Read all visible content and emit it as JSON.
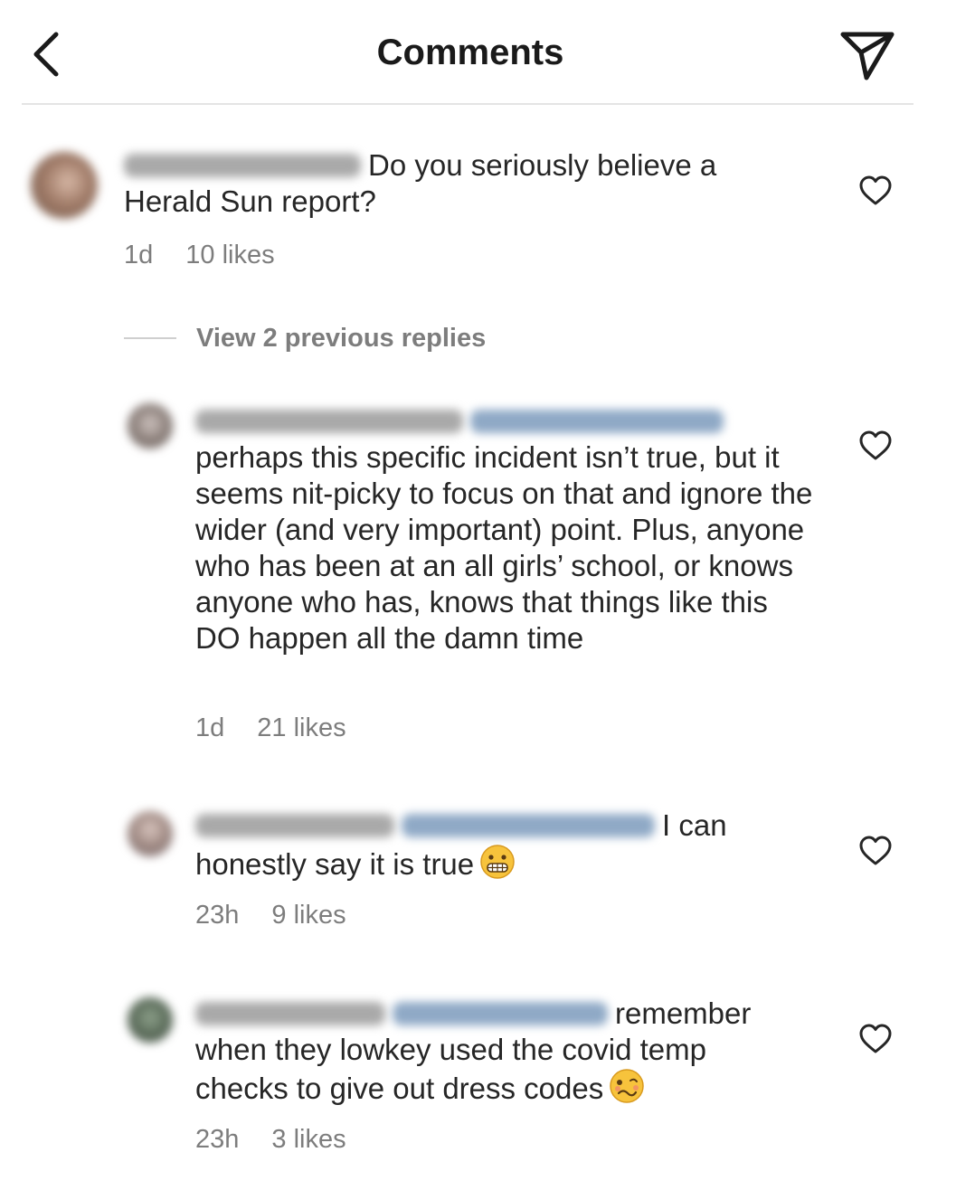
{
  "header": {
    "back_icon": "chevron-left-icon",
    "title": "Comments",
    "send_icon": "paper-plane-icon"
  },
  "comments": [
    {
      "text": "Do you seriously believe a Herald Sun report?",
      "time": "1d",
      "likes": "10 likes"
    },
    {
      "text": "perhaps this specific incident isn’t true, but it seems nit-picky to focus on that and ignore the wider (and very important) point. Plus, anyone who has been at an all girls’ school, or knows anyone who has, knows that things like this DO happen all the damn time",
      "time": "1d",
      "likes": "21 likes"
    },
    {
      "text": "I can honestly say it is true",
      "emoji": "grimacing-face-icon",
      "time": "23h",
      "likes": "9 likes"
    },
    {
      "text": "remember when they lowkey used the covid temp checks to give out dress codes",
      "emoji": "woozy-face-icon",
      "time": "23h",
      "likes": "3 likes"
    }
  ],
  "view_replies": "View 2 previous replies",
  "like_icon": "heart-outline-icon"
}
